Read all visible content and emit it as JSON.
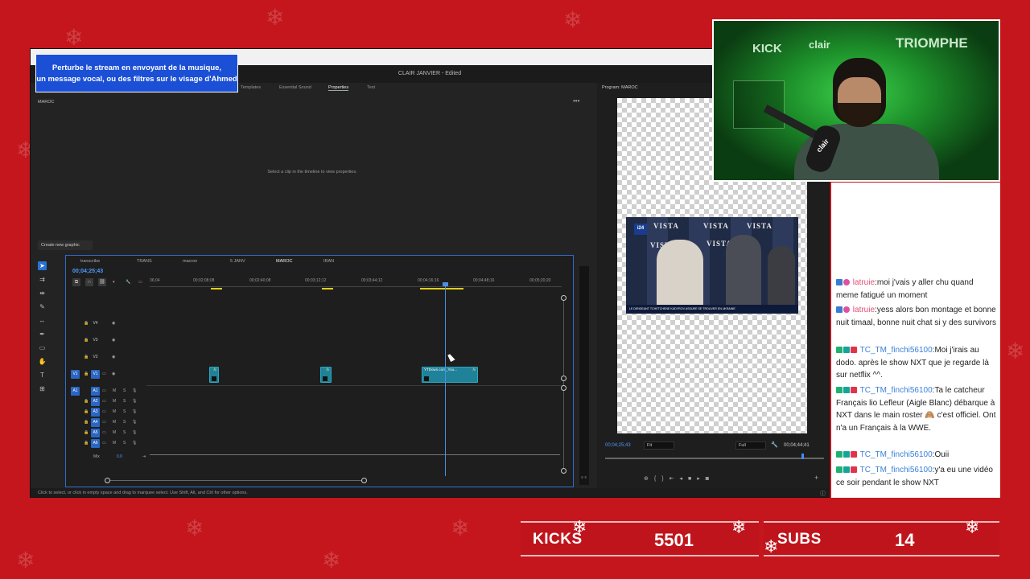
{
  "editor": {
    "project_title": "CLAIR JANVIER - Edited",
    "panel_tabs": [
      "Templates",
      "Essential Sound",
      "Properties",
      "Text"
    ],
    "panel_name": "MAROC",
    "properties_message": "Select a clip in the timeline to view properties.",
    "create_graphic": "Create new graphic",
    "status_text": "Click to select, or click in empty space and drag to marquee select. Use Shift, Alt, and Ctrl for other options."
  },
  "notification": {
    "line1": "Perturbe le stream en envoyant de la musique,",
    "line2": "un message vocal, ou des filtres sur le visage d'Ahmed"
  },
  "program": {
    "label": "Program: MAROC",
    "timecode_left": "00;04;25;43",
    "fit": "Fit",
    "quality": "Full",
    "timecode_right": "00;04;44;41",
    "news_brand": "i24",
    "news_backdrop": "VISTA",
    "news_ticker": "LE DIRIGEANT TCHETCHENE KADYROV ASSURE SE TROUVER EN UKRAINE"
  },
  "timeline": {
    "tabs": [
      "transcribe",
      "TRANS",
      "macron",
      "5 JANV",
      "MAROC",
      "IRAN"
    ],
    "active_tab": "MAROC",
    "timecode": "00;04;25;43",
    "ruler": [
      "36;04",
      "00;02;08;08",
      "00;02;40;08",
      "00;03;12;12",
      "00;03;44;12",
      "00;04;16;16",
      "00;04;48;16",
      "00;05;20;20"
    ],
    "video_tracks": [
      "V4",
      "V3",
      "V2",
      "V1"
    ],
    "audio_tracks": [
      "A1",
      "A2",
      "A3",
      "A4",
      "A5",
      "A6"
    ],
    "clip_label": "YTDown.com_You...",
    "fx": "fx",
    "mix_label": "Mix",
    "mix_value": "0.0",
    "meter_label": "S S"
  },
  "chat": [
    {
      "user": "latruie",
      "text": "moi j'vais y aller chu quand meme fatigué un moment",
      "color": "#e04f78"
    },
    {
      "user": "latruie",
      "text": "yess alors bon montage et bonne nuit timaal, bonne nuit chat si y des survivors",
      "color": "#e04f78"
    },
    {
      "user": "TC_TM_finchi56100",
      "text": "Moi j'irais au dodo. après le show NXT que je regarde là sur netflix ^^.",
      "color": "#3a80d8"
    },
    {
      "user": "TC_TM_finchi56100",
      "text": "Ta le catcheur Français lio Lefleur (Aigle Blanc) débarque à NXT dans le main roster 🙈 c'est officiel. Ont n'a un Français à la WWE.",
      "color": "#3a80d8"
    },
    {
      "user": "TC_TM_finchi56100",
      "text": "Ouii",
      "color": "#3a80d8"
    },
    {
      "user": "TC_TM_finchi56100",
      "text": "y'a eu une vidéo ce soir pendant le show NXT",
      "color": "#3a80d8"
    }
  ],
  "counters": {
    "kicks_label": "KICKS",
    "kicks_value": "5501",
    "subs_label": "SUBS",
    "subs_value": "14"
  },
  "webcam": {
    "sign_left": "KICK",
    "sign_mid": "clair",
    "sign_right": "TRIOMPHE",
    "mic_label": "clair"
  }
}
